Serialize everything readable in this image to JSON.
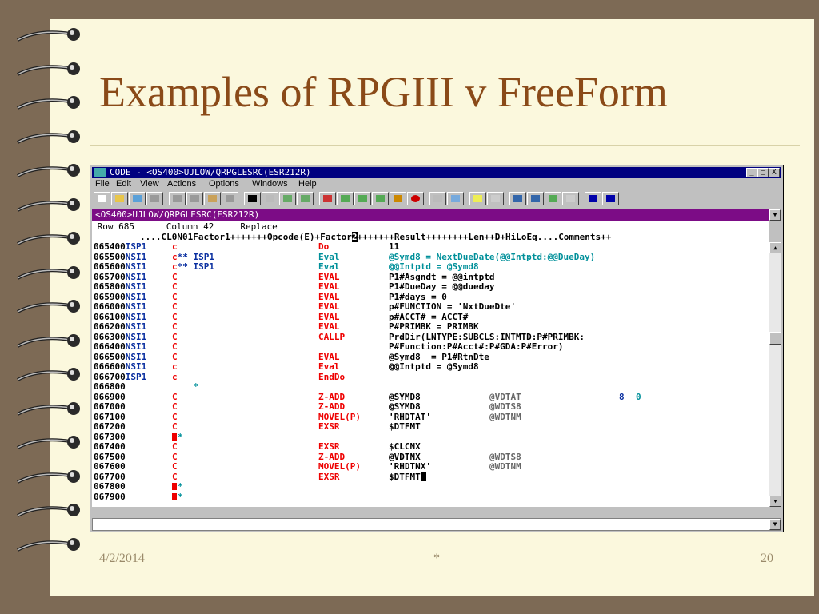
{
  "slide": {
    "title": "Examples of RPGIII v FreeForm",
    "date": "4/2/2014",
    "center": "*",
    "page": "20"
  },
  "window": {
    "title": "CODE - <OS400>UJLOW/QRPGLESRC(ESR212R)",
    "buttons": [
      "_",
      "□",
      "X"
    ],
    "menu": [
      "File",
      "Edit",
      "View",
      "Actions",
      "Options",
      "Windows",
      "Help"
    ],
    "doc_title": "<OS400>UJLOW/QRPGLESRC(ESR212R)"
  },
  "editor": {
    "status": " Row 685      Column 42     Replace",
    "ruler_before": "....CL0N01Factor1+++++++Opcode(E)+Factor",
    "ruler_cursor": "2",
    "ruler_after": "+++++++Result++++++++Len++D+HiLoEq....Comments++"
  },
  "lines": [
    {
      "seq": "065400",
      "src": "ISP1",
      "spec": "c",
      "op": "Do",
      "f2": "11",
      "res": "",
      "len": "",
      "dec": "",
      "color": "red"
    },
    {
      "seq": "065500",
      "src": "NSI1",
      "spec": "c** ISP1",
      "op": "Eval",
      "f2": "@Symd8 = NextDueDate(@@Intptd:@@DueDay)",
      "res": "",
      "len": "",
      "dec": "",
      "color": "teal"
    },
    {
      "seq": "065600",
      "src": "NSI1",
      "spec": "c** ISP1",
      "op": "Eval",
      "f2": "@@Intptd = @Symd8",
      "res": "",
      "len": "",
      "dec": "",
      "color": "teal"
    },
    {
      "seq": "065700",
      "src": "NSI1",
      "spec": "C",
      "op": "EVAL",
      "f2": "P1#Asgndt = @@intptd",
      "res": "",
      "len": "",
      "dec": "",
      "color": "black"
    },
    {
      "seq": "065800",
      "src": "NSI1",
      "spec": "C",
      "op": "EVAL",
      "f2": "P1#DueDay = @@dueday",
      "res": "",
      "len": "",
      "dec": "",
      "color": "black"
    },
    {
      "seq": "065900",
      "src": "NSI1",
      "spec": "C",
      "op": "EVAL",
      "f2": "P1#days = 0",
      "res": "",
      "len": "",
      "dec": "",
      "color": "black"
    },
    {
      "seq": "066000",
      "src": "NSI1",
      "spec": "C",
      "op": "EVAL",
      "f2": "p#FUNCTION = 'NxtDueDte'",
      "res": "",
      "len": "",
      "dec": "",
      "color": "black"
    },
    {
      "seq": "066100",
      "src": "NSI1",
      "spec": "C",
      "op": "EVAL",
      "f2": "p#ACCT# = ACCT#",
      "res": "",
      "len": "",
      "dec": "",
      "color": "black"
    },
    {
      "seq": "066200",
      "src": "NSI1",
      "spec": "C",
      "op": "EVAL",
      "f2": "P#PRIMBK = PRIMBK",
      "res": "",
      "len": "",
      "dec": "",
      "color": "black"
    },
    {
      "seq": "066300",
      "src": "NSI1",
      "spec": "C",
      "op": "CALLP",
      "f2": "PrdDir(LNTYPE:SUBCLS:INTMTD:P#PRIMBK:",
      "res": "",
      "len": "",
      "dec": "",
      "color": "black"
    },
    {
      "seq": "066400",
      "src": "NSI1",
      "spec": "C",
      "op": "",
      "f2": "P#Function:P#Acct#:P#GDA:P#Error)",
      "res": "",
      "len": "",
      "dec": "",
      "color": "black"
    },
    {
      "seq": "066500",
      "src": "NSI1",
      "spec": "C",
      "op": "EVAL",
      "f2": "@Symd8  = P1#RtnDte",
      "res": "",
      "len": "",
      "dec": "",
      "color": "black"
    },
    {
      "seq": "066600",
      "src": "NSI1",
      "spec": "c",
      "op": "Eval",
      "f2": "@@Intptd = @Symd8",
      "res": "",
      "len": "",
      "dec": "",
      "color": "black"
    },
    {
      "seq": "066700",
      "src": "ISP1",
      "spec": "c",
      "op": "EndDo",
      "f2": "",
      "res": "",
      "len": "",
      "dec": "",
      "color": "black"
    },
    {
      "seq": "066800",
      "src": "",
      "spec": "    *",
      "op": "",
      "f2": "",
      "res": "",
      "len": "",
      "dec": "",
      "color": "teal"
    },
    {
      "seq": "066900",
      "src": "",
      "spec": "C",
      "op": "Z-ADD",
      "f2": "@SYMD8",
      "res": "@VDTAT",
      "len": "8",
      "dec": "0",
      "color": "black"
    },
    {
      "seq": "067000",
      "src": "",
      "spec": "C",
      "op": "Z-ADD",
      "f2": "@SYMD8",
      "res": "@WDTS8",
      "len": "",
      "dec": "",
      "color": "black"
    },
    {
      "seq": "067100",
      "src": "",
      "spec": "C",
      "op": "MOVEL(P)",
      "f2": "'RHDTAT'",
      "res": "@WDTNM",
      "len": "",
      "dec": "",
      "color": "black"
    },
    {
      "seq": "067200",
      "src": "",
      "spec": "C",
      "op": "EXSR",
      "f2": "$DTFMT",
      "res": "",
      "len": "",
      "dec": "",
      "color": "black"
    },
    {
      "seq": "067300",
      "src": "",
      "spec": "■*",
      "op": "",
      "f2": "",
      "res": "",
      "len": "",
      "dec": "",
      "color": "teal"
    },
    {
      "seq": "067400",
      "src": "",
      "spec": "C",
      "op": "EXSR",
      "f2": "$CLCNX",
      "res": "",
      "len": "",
      "dec": "",
      "color": "black"
    },
    {
      "seq": "067500",
      "src": "",
      "spec": "C",
      "op": "Z-ADD",
      "f2": "@VDTNX",
      "res": "@WDTS8",
      "len": "",
      "dec": "",
      "color": "black"
    },
    {
      "seq": "067600",
      "src": "",
      "spec": "C",
      "op": "MOVEL(P)",
      "f2": "'RHDTNX'",
      "res": "@WDTNM",
      "len": "",
      "dec": "",
      "color": "black"
    },
    {
      "seq": "067700",
      "src": "",
      "spec": "C",
      "op": "EXSR",
      "f2": "$DTFMT",
      "res": "",
      "len": "",
      "dec": "",
      "color": "black"
    },
    {
      "seq": "067800",
      "src": "",
      "spec": "■*",
      "op": "",
      "f2": "",
      "res": "",
      "len": "",
      "dec": "",
      "color": "teal"
    },
    {
      "seq": "067900",
      "src": "",
      "spec": "■*",
      "op": "",
      "f2": "",
      "res": "",
      "len": "",
      "dec": "",
      "color": "teal"
    }
  ],
  "colors": {
    "title": "#8a4a18",
    "titlebar": "#000080",
    "docbar": "#7c0c86",
    "spec_red": "#e00000",
    "teal": "#00909a",
    "blue": "#0a2fa0"
  }
}
